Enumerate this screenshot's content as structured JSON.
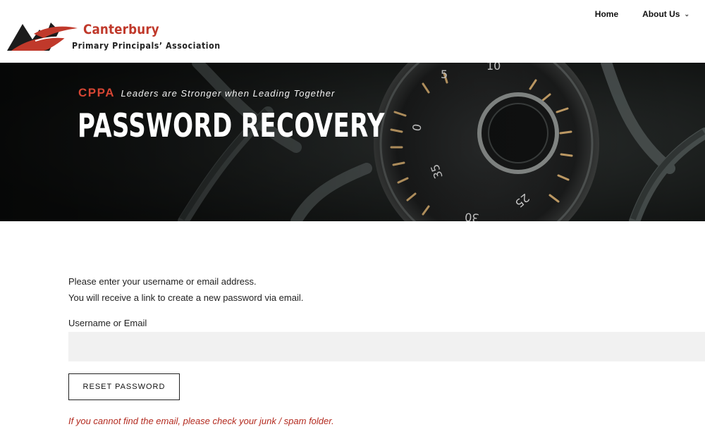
{
  "header": {
    "logo": {
      "title": "Canterbury",
      "subtitle": "Primary Principals’ Association",
      "icon": "mountain-logo-icon"
    },
    "nav": [
      {
        "label": "Home",
        "icon": null
      },
      {
        "label": "About Us",
        "icon": "chevron-down-icon"
      }
    ]
  },
  "hero": {
    "brand": "CPPA",
    "slogan": "Leaders are Stronger when Leading Together",
    "title": "PASSWORD RECOVERY"
  },
  "form": {
    "instruction_line1": "Please enter your username or email address.",
    "instruction_line2": "You will receive a link to create a new password via email.",
    "username_label": "Username or Email",
    "username_value": "",
    "username_placeholder": "",
    "reset_button_label": "RESET PASSWORD",
    "spam_note": "If you cannot find the email, please check your junk / spam folder."
  },
  "colors": {
    "brand_red": "#c0392b",
    "note_red": "#b32a1f",
    "hero_bg": "#1a1d1c"
  }
}
